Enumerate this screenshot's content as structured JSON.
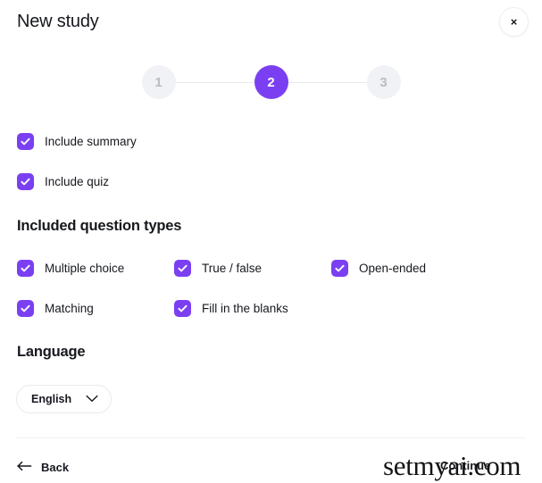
{
  "header": {
    "title": "New study",
    "close_label": "×"
  },
  "stepper": {
    "active_step": 2,
    "steps": [
      {
        "label": "1",
        "state": "inactive"
      },
      {
        "label": "2",
        "state": "active"
      },
      {
        "label": "3",
        "state": "inactive"
      }
    ],
    "active_color": "#7b3ff2",
    "inactive_color": "#f1f2f5",
    "inactive_text_color": "#b7bcc5"
  },
  "options": {
    "include_summary": {
      "label": "Include summary",
      "checked": true
    },
    "include_quiz": {
      "label": "Include quiz",
      "checked": true
    }
  },
  "question_types": {
    "heading": "Included question types",
    "items": [
      {
        "label": "Multiple choice",
        "checked": true
      },
      {
        "label": "True / false",
        "checked": true
      },
      {
        "label": "Open-ended",
        "checked": true
      },
      {
        "label": "Matching",
        "checked": true
      },
      {
        "label": "Fill in the blanks",
        "checked": true
      }
    ]
  },
  "language": {
    "heading": "Language",
    "selected": "English"
  },
  "footer": {
    "back_label": "Back",
    "continue_label": "Continue"
  },
  "watermark": {
    "text": "setmyai.com"
  },
  "colors": {
    "accent": "#7b3ff2",
    "text": "#16181d",
    "muted": "#b7bcc5",
    "border": "#e8eaee",
    "divider": "#eef0f3"
  }
}
